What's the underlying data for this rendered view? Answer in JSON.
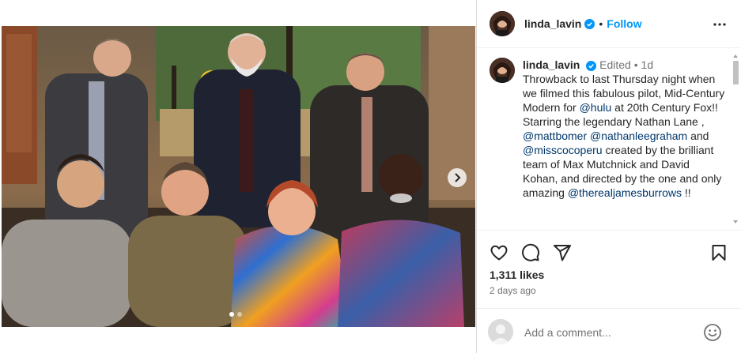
{
  "post": {
    "photo_alt": "",
    "carousel": {
      "slides": 2,
      "current": 1
    }
  },
  "header": {
    "username": "linda_lavin",
    "separator": "•",
    "follow_label": "Follow"
  },
  "caption": {
    "username": "linda_lavin",
    "edited": "Edited",
    "separator": "•",
    "age": "1d",
    "segments": [
      {
        "t": "text",
        "v": "Throwback to last Thursday night when we filmed this fabulous pilot, Mid-Century Modern for "
      },
      {
        "t": "mention",
        "v": "@hulu"
      },
      {
        "t": "text",
        "v": " at 20th Century Fox!! Starring the legendary Nathan Lane , "
      },
      {
        "t": "mention",
        "v": "@mattbomer"
      },
      {
        "t": "text",
        "v": " "
      },
      {
        "t": "mention",
        "v": "@nathanleegraham"
      },
      {
        "t": "text",
        "v": " and "
      },
      {
        "t": "mention",
        "v": "@misscocoperu"
      },
      {
        "t": "text",
        "v": " created by the brilliant team of Max Mutchnick and David Kohan, and directed by the one and only amazing "
      },
      {
        "t": "mention",
        "v": "@therealjamesburrows"
      },
      {
        "t": "text",
        "v": " !!"
      }
    ]
  },
  "actions": {
    "like_icon": "heart-icon",
    "comment_icon": "comment-icon",
    "share_icon": "share-icon",
    "save_icon": "bookmark-icon"
  },
  "likes": "1,311 likes",
  "posted": "2 days ago",
  "comment": {
    "placeholder": "Add a comment..."
  },
  "colors": {
    "accent": "#0095f6",
    "mention": "#00376b",
    "muted": "#737373",
    "verified": "#0095f6"
  }
}
